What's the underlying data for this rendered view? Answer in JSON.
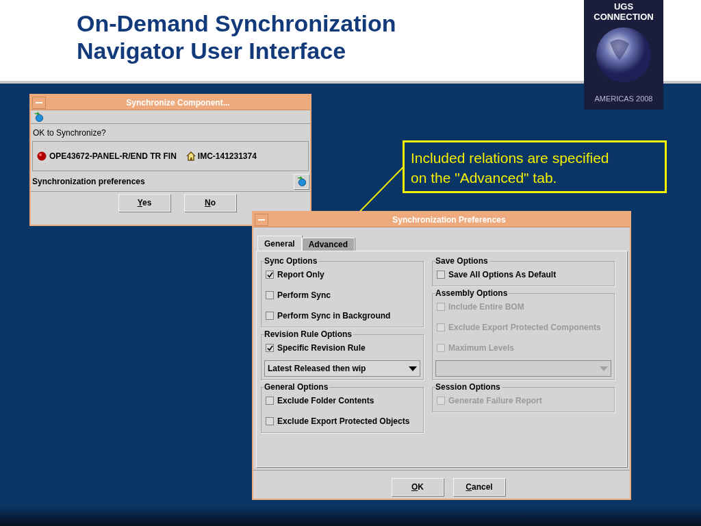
{
  "slide": {
    "title_lines": [
      "On-Demand Synchronization",
      "Navigator User Interface"
    ],
    "logo": {
      "name": "UGS CONNECTION",
      "edition": "AMERICAS 2008"
    }
  },
  "callout": {
    "text_lines": [
      "Included relations are specified",
      "on the \"Advanced\" tab."
    ]
  },
  "confirm_dialog": {
    "title": "Synchronize Component...",
    "question": "OK to Synchronize?",
    "component": "OPE43672-PANEL-R/END TR FIN",
    "item": "IMC-141231374",
    "preferences_label": "Synchronization preferences",
    "buttons": [
      {
        "label": "Yes"
      },
      {
        "label": "No"
      }
    ]
  },
  "preferences_dialog": {
    "title": "Synchronization Preferences",
    "tabs": [
      {
        "label": "General",
        "selected": true
      },
      {
        "label": "Advanced",
        "selected": false
      }
    ],
    "columns": [
      [
        {
          "title": "Sync Options",
          "items": [
            {
              "kind": "checkbox",
              "label": "Report Only",
              "checked": true,
              "disabled": false
            },
            {
              "kind": "checkbox",
              "label": "Perform Sync",
              "checked": false,
              "disabled": false
            },
            {
              "kind": "checkbox",
              "label": "Perform Sync in Background",
              "checked": false,
              "disabled": false
            }
          ]
        },
        {
          "title": "Revision Rule Options",
          "items": [
            {
              "kind": "checkbox",
              "label": "Specific Revision Rule",
              "checked": true,
              "disabled": false
            },
            {
              "kind": "dropdown",
              "value": "Latest Released then wip",
              "disabled": false
            }
          ]
        },
        {
          "title": "General Options",
          "items": [
            {
              "kind": "checkbox",
              "label": "Exclude Folder Contents",
              "checked": false,
              "disabled": false
            },
            {
              "kind": "checkbox",
              "label": "Exclude Export Protected Objects",
              "checked": false,
              "disabled": false
            }
          ]
        }
      ],
      [
        {
          "title": "Save Options",
          "items": [
            {
              "kind": "checkbox",
              "label": "Save All Options As Default",
              "checked": false,
              "disabled": false
            }
          ]
        },
        {
          "title": "Assembly Options",
          "items": [
            {
              "kind": "checkbox",
              "label": "Include Entire BOM",
              "checked": false,
              "disabled": true
            },
            {
              "kind": "checkbox",
              "label": "Exclude Export Protected Components",
              "checked": false,
              "disabled": true
            },
            {
              "kind": "checkbox",
              "label": "Maximum Levels",
              "checked": false,
              "disabled": true
            },
            {
              "kind": "dropdown",
              "disabled": true
            }
          ]
        },
        {
          "title": "Session Options",
          "items": [
            {
              "kind": "checkbox",
              "label": "Generate Failure Report",
              "checked": false,
              "disabled": true
            }
          ]
        }
      ]
    ],
    "buttons": [
      {
        "label": "OK"
      },
      {
        "label": "Cancel"
      }
    ]
  }
}
